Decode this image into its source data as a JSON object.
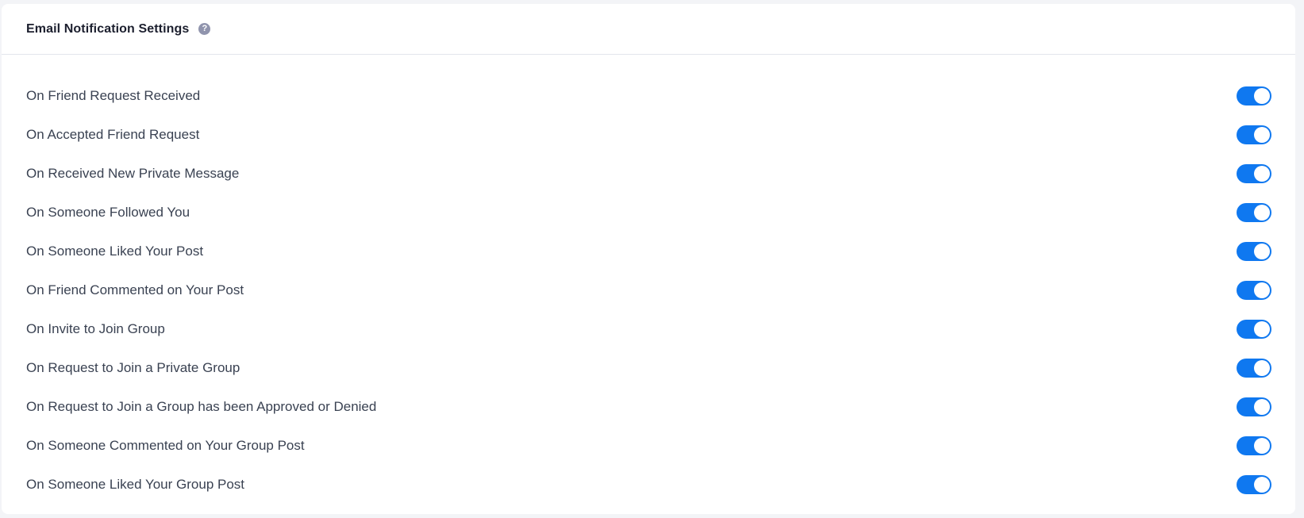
{
  "header": {
    "title": "Email Notification Settings",
    "help_icon": "question-circle-icon"
  },
  "settings": [
    {
      "label": "On Friend Request Received",
      "enabled": true
    },
    {
      "label": "On Accepted Friend Request",
      "enabled": true
    },
    {
      "label": "On Received New Private Message",
      "enabled": true
    },
    {
      "label": "On Someone Followed You",
      "enabled": true
    },
    {
      "label": "On Someone Liked Your Post",
      "enabled": true
    },
    {
      "label": "On Friend Commented on Your Post",
      "enabled": true
    },
    {
      "label": "On Invite to Join Group",
      "enabled": true
    },
    {
      "label": "On Request to Join a Private Group",
      "enabled": true
    },
    {
      "label": "On Request to Join a Group has been Approved or Denied",
      "enabled": true
    },
    {
      "label": "On Someone Commented on Your Group Post",
      "enabled": true
    },
    {
      "label": "On Someone Liked Your Group Post",
      "enabled": true
    }
  ],
  "colors": {
    "toggle_on": "#0f78f0",
    "toggle_off": "#c8ccd6"
  }
}
